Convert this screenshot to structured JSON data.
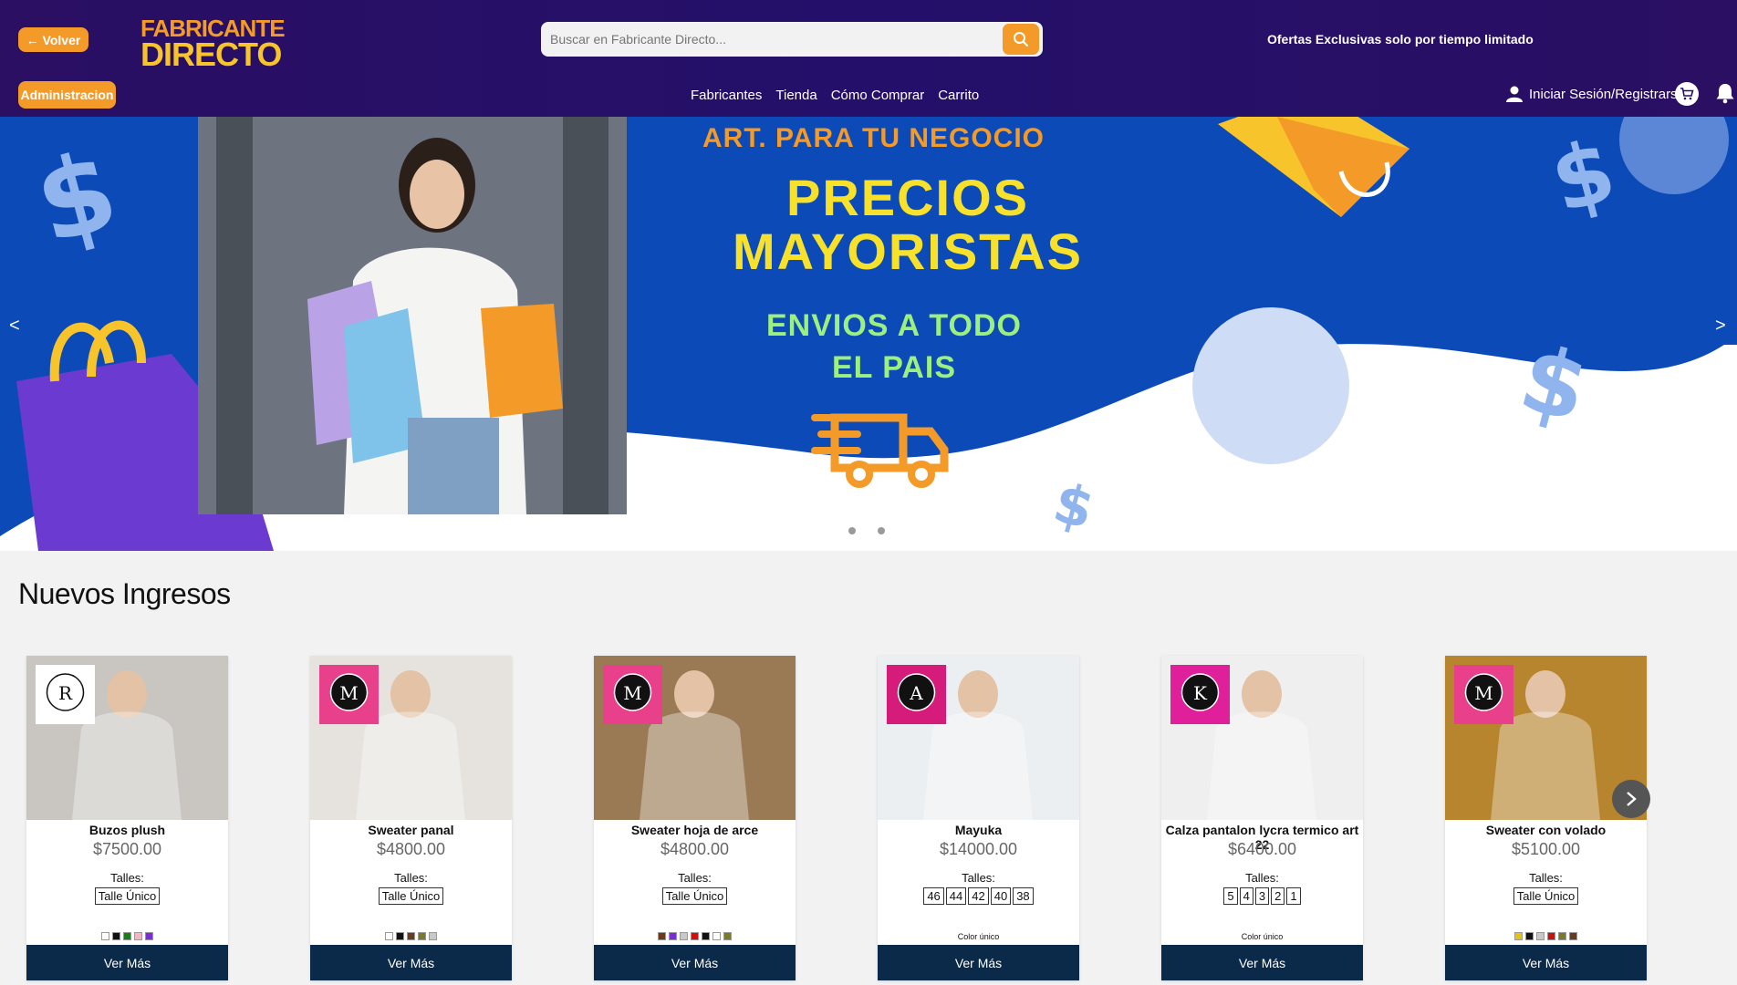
{
  "header": {
    "back_label": "← Volver",
    "admin_label": "Administracion",
    "logo_line1": "FABRICANTE",
    "logo_line2": "DIRECTO",
    "search_placeholder": "Buscar en Fabricante Directo...",
    "promo_text": "Ofertas Exclusivas solo por tiempo limitado",
    "nav": [
      "Fabricantes",
      "Tienda",
      "Cómo Comprar",
      "Carrito"
    ],
    "login_label": "Iniciar Sesión/Registrarse"
  },
  "banner": {
    "line1": "ART. PARA TU NEGOCIO",
    "line2a": "PRECIOS",
    "line2b": "MAYORISTAS",
    "line3a": "ENVIOS A TODO",
    "line3b": "EL PAIS",
    "prev": "<",
    "next": ">"
  },
  "section": {
    "title": "Nuevos Ingresos"
  },
  "products": [
    {
      "name": "Buzos plush",
      "price": "$7500.00",
      "talles_label": "Talles:",
      "sizes": [
        "Talle Único"
      ],
      "colors": [
        "#ffffff",
        "#111111",
        "#1f7a1f",
        "#f4b6c2",
        "#7b2fd0"
      ],
      "color_label": "",
      "cta": "Ver Más",
      "brand_icon": "r-crown-logo-icon",
      "img_bg": "#c9c6c2"
    },
    {
      "name": "Sweater panal",
      "price": "$4800.00",
      "talles_label": "Talles:",
      "sizes": [
        "Talle Único"
      ],
      "colors": [
        "#ffffff",
        "#111111",
        "#6b3a1e",
        "#7a7a2a",
        "#c8c8c8"
      ],
      "color_label": "",
      "cta": "Ver Más",
      "brand_icon": "manu-zumasa-logo-icon",
      "img_bg": "#e6e3df"
    },
    {
      "name": "Sweater hoja de arce",
      "price": "$4800.00",
      "talles_label": "Talles:",
      "sizes": [
        "Talle Único"
      ],
      "colors": [
        "#6b3a1e",
        "#7b2fd0",
        "#c8c8c8",
        "#cc1111",
        "#111111",
        "#ffffff",
        "#7a7a2a"
      ],
      "color_label": "",
      "cta": "Ver Más",
      "brand_icon": "manu-zumasa-logo-icon",
      "img_bg": "#9a7a55"
    },
    {
      "name": "Mayuka",
      "price": "$14000.00",
      "talles_label": "Talles:",
      "sizes": [
        "46",
        "44",
        "42",
        "40",
        "38"
      ],
      "colors": [],
      "color_label": "Color único",
      "cta": "Ver Más",
      "brand_icon": "africa-mia-jeans-logo-icon",
      "img_bg": "#eceff2"
    },
    {
      "name": "Calza pantalon lycra termico art 22",
      "price": "$6400.00",
      "talles_label": "Talles:",
      "sizes": [
        "5",
        "4",
        "3",
        "2",
        "1"
      ],
      "colors": [],
      "color_label": "Color único",
      "cta": "Ver Más",
      "brand_icon": "khansas-logo-icon",
      "img_bg": "#efefef"
    },
    {
      "name": "Sweater con volado",
      "price": "$5100.00",
      "talles_label": "Talles:",
      "sizes": [
        "Talle Único"
      ],
      "colors": [
        "#e6c20f",
        "#111111",
        "#c8c8c8",
        "#cc1111",
        "#7a7a2a",
        "#6b3a1e"
      ],
      "color_label": "",
      "cta": "Ver Más",
      "brand_icon": "manu-zumasa-logo-icon",
      "img_bg": "#b7852e"
    }
  ],
  "colors": {
    "header_bg": "#24106a",
    "accent": "#f39a29",
    "banner_bg": "#0c4ab8",
    "cta_bg": "#0b2a4a"
  }
}
